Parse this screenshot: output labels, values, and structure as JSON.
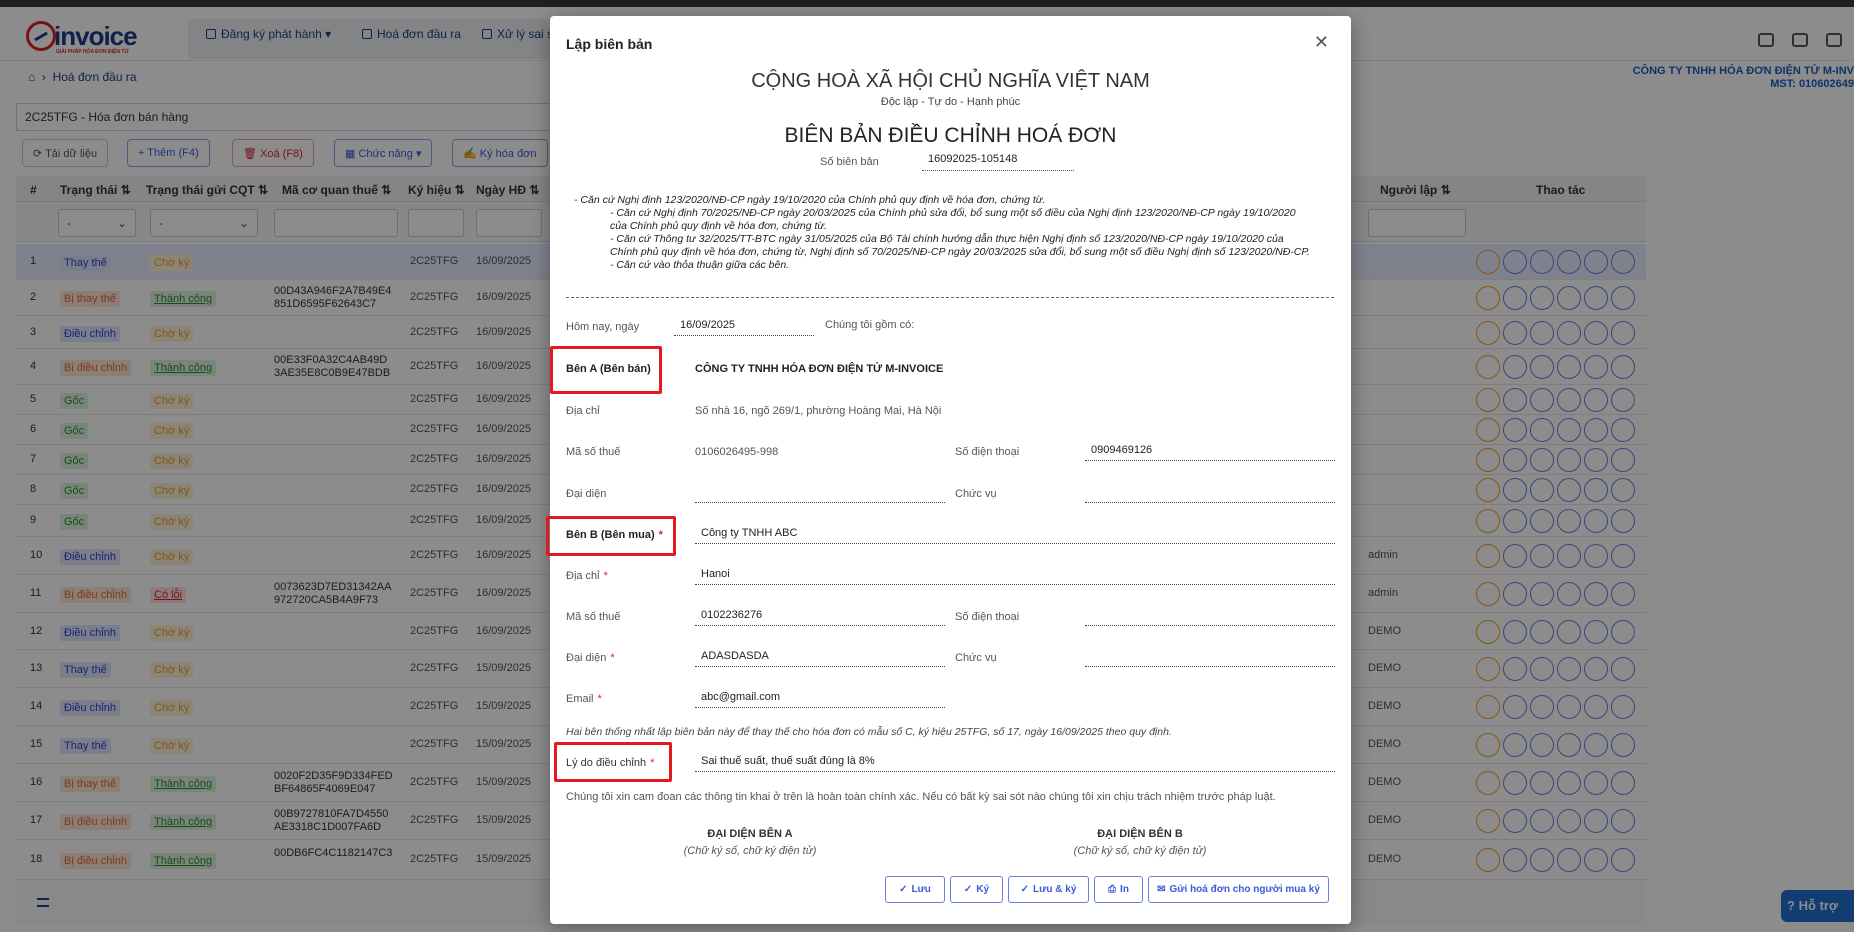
{
  "app": {
    "nav": [
      {
        "label": "Đăng ký phát hành"
      },
      {
        "label": "Hoá đơn đầu ra"
      },
      {
        "label": "Xử lý sai s"
      }
    ],
    "breadcrumb": "Hoá đơn đầu ra",
    "company_name": "CÔNG TY TNHH HÓA ĐƠN ĐIỆN TỬ M-INV",
    "company_tax": "MST: 010602649",
    "invoice_type": "2C25TFG - Hóa đơn bán hàng",
    "toolbar": {
      "reload": "Tải dữ liệu",
      "add": "Thêm (F4)",
      "delete": "Xoá (F8)",
      "functions": "Chức năng",
      "sign": "Ký hóa đơn"
    },
    "columns": {
      "num": "#",
      "status": "Trạng thái",
      "cqt_status": "Trạng thái gửi CQT",
      "tax_code": "Mã cơ quan thuế",
      "symbol": "Ký hiệu",
      "date": "Ngày HĐ",
      "creator": "Người lập",
      "actions": "Thao tác"
    },
    "filter_placeholder": "-",
    "rows": [
      {
        "num": "1",
        "status": "Thay thế",
        "cqt": "Chờ ký",
        "code": "",
        "symbol": "2C25TFG",
        "date": "16/09/2025",
        "user": ""
      },
      {
        "num": "2",
        "status": "Bị thay thế",
        "cqt": "Thành công",
        "code": "00D43A946F2A7B49E4\n851D6595F62643C7",
        "symbol": "2C25TFG",
        "date": "16/09/2025",
        "user": ""
      },
      {
        "num": "3",
        "status": "Điều chỉnh",
        "cqt": "Chờ ký",
        "code": "",
        "symbol": "2C25TFG",
        "date": "16/09/2025",
        "user": ""
      },
      {
        "num": "4",
        "status": "Bị điều chỉnh",
        "cqt": "Thành công",
        "code": "00E33F0A32C4AB49D\n3AE35E8C0B9E47BDB",
        "symbol": "2C25TFG",
        "date": "16/09/2025",
        "user": ""
      },
      {
        "num": "5",
        "status": "Gốc",
        "cqt": "Chờ ký",
        "code": "",
        "symbol": "2C25TFG",
        "date": "16/09/2025",
        "user": ""
      },
      {
        "num": "6",
        "status": "Gốc",
        "cqt": "Chờ ký",
        "code": "",
        "symbol": "2C25TFG",
        "date": "16/09/2025",
        "user": ""
      },
      {
        "num": "7",
        "status": "Gốc",
        "cqt": "Chờ ký",
        "code": "",
        "symbol": "2C25TFG",
        "date": "16/09/2025",
        "user": ""
      },
      {
        "num": "8",
        "status": "Gốc",
        "cqt": "Chờ ký",
        "code": "",
        "symbol": "2C25TFG",
        "date": "16/09/2025",
        "user": ""
      },
      {
        "num": "9",
        "status": "Gốc",
        "cqt": "Chờ ký",
        "code": "",
        "symbol": "2C25TFG",
        "date": "16/09/2025",
        "user": ""
      },
      {
        "num": "10",
        "status": "Điều chỉnh",
        "cqt": "Chờ ký",
        "code": "",
        "symbol": "2C25TFG",
        "date": "16/09/2025",
        "user": "admin"
      },
      {
        "num": "11",
        "status": "Bị điều chỉnh",
        "cqt": "Có lỗi",
        "code": "0073623D7ED31342AA\n972720CA5B4A9F73",
        "symbol": "2C25TFG",
        "date": "16/09/2025",
        "user": "admin"
      },
      {
        "num": "12",
        "status": "Điều chỉnh",
        "cqt": "Chờ ký",
        "code": "",
        "symbol": "2C25TFG",
        "date": "16/09/2025",
        "user": "DEMO"
      },
      {
        "num": "13",
        "status": "Thay thế",
        "cqt": "Chờ ký",
        "code": "",
        "symbol": "2C25TFG",
        "date": "15/09/2025",
        "user": "DEMO"
      },
      {
        "num": "14",
        "status": "Điều chỉnh",
        "cqt": "Chờ ký",
        "code": "",
        "symbol": "2C25TFG",
        "date": "15/09/2025",
        "user": "DEMO"
      },
      {
        "num": "15",
        "status": "Thay thế",
        "cqt": "Chờ ký",
        "code": "",
        "symbol": "2C25TFG",
        "date": "15/09/2025",
        "user": "DEMO"
      },
      {
        "num": "16",
        "status": "Bị thay thế",
        "cqt": "Thành công",
        "code": "0020F2D35F9D334FED\nBF64865F4069E047",
        "symbol": "2C25TFG",
        "date": "15/09/2025",
        "user": "DEMO"
      },
      {
        "num": "17",
        "status": "Bị điều chỉnh",
        "cqt": "Thành công",
        "code": "00B9727810FA7D4550\nAE3318C1D007FA6D",
        "symbol": "2C25TFG",
        "date": "15/09/2025",
        "user": "DEMO"
      },
      {
        "num": "18",
        "status": "Bị điều chỉnh",
        "cqt": "Thành công",
        "code": "00DB6FC4C1182147C3",
        "symbol": "2C25TFG",
        "date": "15/09/2025",
        "user": "DEMO"
      }
    ],
    "help": "Hỗ trợ"
  },
  "modal": {
    "title": "Lập biên bản",
    "nation": "CỘNG HOÀ XÃ HỘI CHỦ NGHĨA VIỆT NAM",
    "motto": "Độc lập - Tự do - Hạnh phúc",
    "doc_title": "BIÊN BẢN ĐIỀU CHỈNH HOÁ ĐƠN",
    "record_no_label": "Số biên bản",
    "record_no": "16092025-105148",
    "basis": [
      "- Căn cứ Nghị định 123/2020/NĐ-CP ngày 19/10/2020 của Chính phủ quy định về hóa đơn, chứng từ.",
      "- Căn cứ Nghị định 70/2025/NĐ-CP ngày 20/03/2025 của Chính phủ sửa đổi, bổ sung một số điều của Nghị định 123/2020/NĐ-CP ngày 19/10/2020 của Chính phủ quy định về hóa đơn, chứng từ.",
      "- Căn cứ Thông tư 32/2025/TT-BTC ngày 31/05/2025 của Bộ Tài chính hướng dẫn thực hiện Nghị định số 123/2020/NĐ-CP ngày 19/10/2020 của Chính phủ quy định về hóa đơn, chứng từ, Nghị định số 70/2025/NĐ-CP ngày 20/03/2025 sửa đổi, bổ sung một số điều Nghị định số 123/2020/NĐ-CP.",
      "- Căn cứ vào thỏa thuận giữa các bên."
    ],
    "today_label": "Hôm nay, ngày",
    "today": "16/09/2025",
    "we_label": "Chúng tôi gồm có:",
    "party_a": {
      "label": "Bên A (Bên bán)",
      "name": "CÔNG TY TNHH HÓA ĐƠN ĐIỆN TỬ M-INVOICE",
      "address_label": "Địa chỉ",
      "address": "Số nhà 16, ngõ 269/1, phường Hoàng Mai, Hà Nội",
      "tax_label": "Mã số thuế",
      "tax": "0106026495-998",
      "phone_label": "Số điện thoại",
      "phone": "0909469126",
      "rep_label": "Đại diện",
      "rep": "",
      "position_label": "Chức vụ",
      "position": ""
    },
    "party_b": {
      "label": "Bên B (Bên mua)",
      "name": "Công ty TNHH ABC",
      "address_label": "Địa chỉ",
      "address": "Hanoi",
      "tax_label": "Mã số thuế",
      "tax": "0102236276",
      "phone_label": "Số điện thoại",
      "phone": "",
      "rep_label": "Đại diện",
      "rep": "ADASDASDA",
      "position_label": "Chức vụ",
      "position": "",
      "email_label": "Email",
      "email": "abc@gmail.com"
    },
    "required_mark": "*",
    "agreement": "Hai bên thống nhất lập biên bản này để thay thế cho hóa đơn có mẫu số C, ký hiệu 25TFG, số 17, ngày 16/09/2025 theo quy định.",
    "reason_label": "Lý do điều chỉnh",
    "reason": "Sai thuế suất, thuế suất đúng là 8%",
    "commitment": "Chúng tôi xin cam đoan các thông tin khai ở trên là hoàn toàn chính xác. Nếu có bất kỳ sai sót nào chúng tôi xin chịu trách nhiệm trước pháp luật.",
    "sign_a_title": "ĐẠI DIỆN BÊN A",
    "sign_a_sub": "(Chữ ký số, chữ ký điện tử)",
    "sign_b_title": "ĐẠI DIỆN BÊN B",
    "sign_b_sub": "(Chữ ký số, chữ ký điện tử)",
    "buttons": {
      "save": "Lưu",
      "sign": "Ký",
      "save_sign": "Lưu & ký",
      "print": "In",
      "send": "Gửi hoá đơn cho người mua ký"
    }
  }
}
